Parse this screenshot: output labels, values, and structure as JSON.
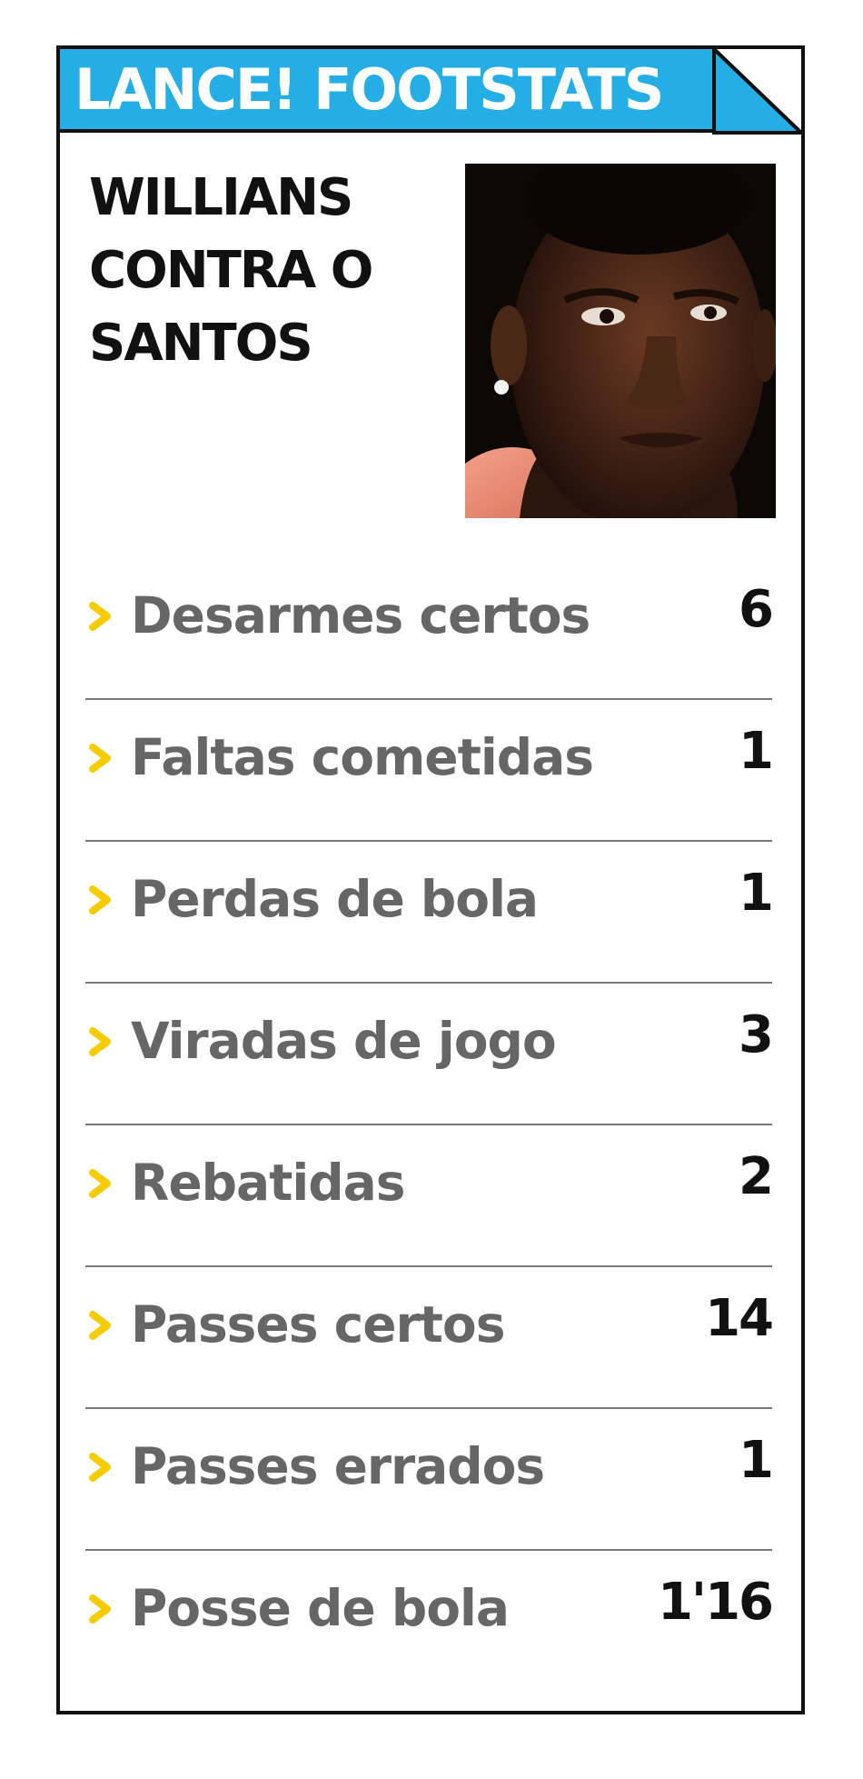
{
  "header": {
    "title": "LANCE! FOOTSTATS",
    "accent_color": "#25aee6",
    "fold_color": "#25aee6"
  },
  "headline": {
    "line1": "WILLIANS",
    "line2": "CONTRA O",
    "line3": "SANTOS"
  },
  "player_photo": {
    "icon": "player-portrait-photo"
  },
  "stats": {
    "bullet_icon": "chevron-right-icon",
    "bullet_color": "#f5cc00",
    "rows": [
      {
        "label": "Desarmes certos",
        "value": "6"
      },
      {
        "label": "Faltas cometidas",
        "value": "1"
      },
      {
        "label": "Perdas de bola",
        "value": "1"
      },
      {
        "label": "Viradas de jogo",
        "value": "3"
      },
      {
        "label": "Rebatidas",
        "value": "2"
      },
      {
        "label": "Passes certos",
        "value": "14"
      },
      {
        "label": "Passes errados",
        "value": "1"
      },
      {
        "label": "Posse de bola",
        "value": "1'16"
      }
    ]
  }
}
